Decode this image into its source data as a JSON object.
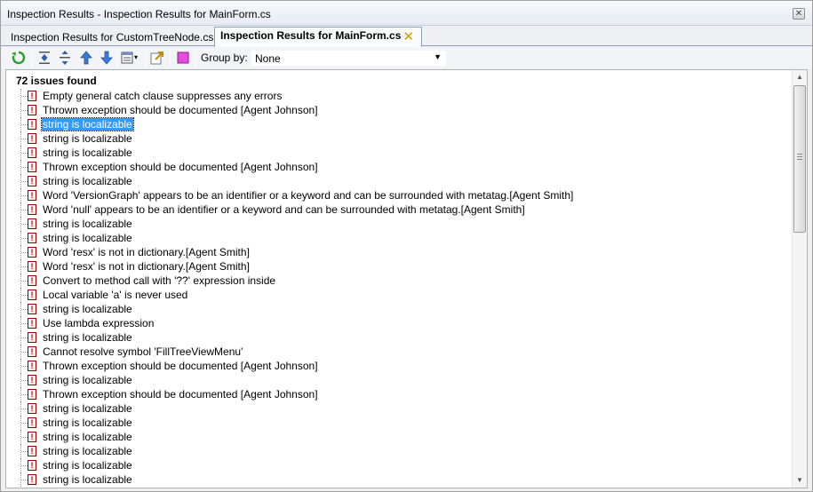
{
  "window": {
    "title": "Inspection Results - Inspection Results for MainForm.cs",
    "close_glyph": "✕"
  },
  "tabs": [
    {
      "label": "Inspection Results for CustomTreeNode.cs",
      "active": false
    },
    {
      "label": "Inspection Results for MainForm.cs",
      "active": true,
      "close_glyph": "✕"
    }
  ],
  "toolbar": {
    "buttons": [
      "refresh-icon",
      "collapse-all-icon",
      "expand-all-icon",
      "previous-issue-icon",
      "next-issue-icon",
      "columns-icon",
      "export-icon",
      "filter-icon"
    ],
    "group_by_label": "Group by:",
    "group_by_value": "None"
  },
  "results": {
    "summary": "72 issues found",
    "selected_index": 2,
    "items": [
      "Empty general catch clause suppresses any errors",
      "Thrown exception should be documented [Agent Johnson]",
      "string is localizable",
      "string is localizable",
      "string is localizable",
      "Thrown exception should be documented [Agent Johnson]",
      "string is localizable",
      "Word 'VersionGraph' appears to be an identifier or a keyword and can be surrounded with metatag.[Agent Smith]",
      "Word 'null' appears to be an identifier or a keyword and can be surrounded with metatag.[Agent Smith]",
      "string is localizable",
      "string is localizable",
      "Word 'resx' is not in dictionary.[Agent Smith]",
      "Word 'resx' is not in dictionary.[Agent Smith]",
      "Convert to method call with '??' expression inside",
      "Local variable 'a' is never used",
      "string is localizable",
      "Use lambda expression",
      "string is localizable",
      "Cannot resolve symbol 'FillTreeViewMenu'",
      "Thrown exception should be documented [Agent Johnson]",
      "string is localizable",
      "Thrown exception should be documented [Agent Johnson]",
      "string is localizable",
      "string is localizable",
      "string is localizable",
      "string is localizable",
      "string is localizable",
      "string is localizable"
    ]
  },
  "issue_icon_glyph": "!",
  "scrollbar": {
    "up_glyph": "▲",
    "down_glyph": "▼"
  },
  "colors": {
    "selection": "#3399ff",
    "issue_icon": "#c00000",
    "tab_close": "#c9a000"
  }
}
